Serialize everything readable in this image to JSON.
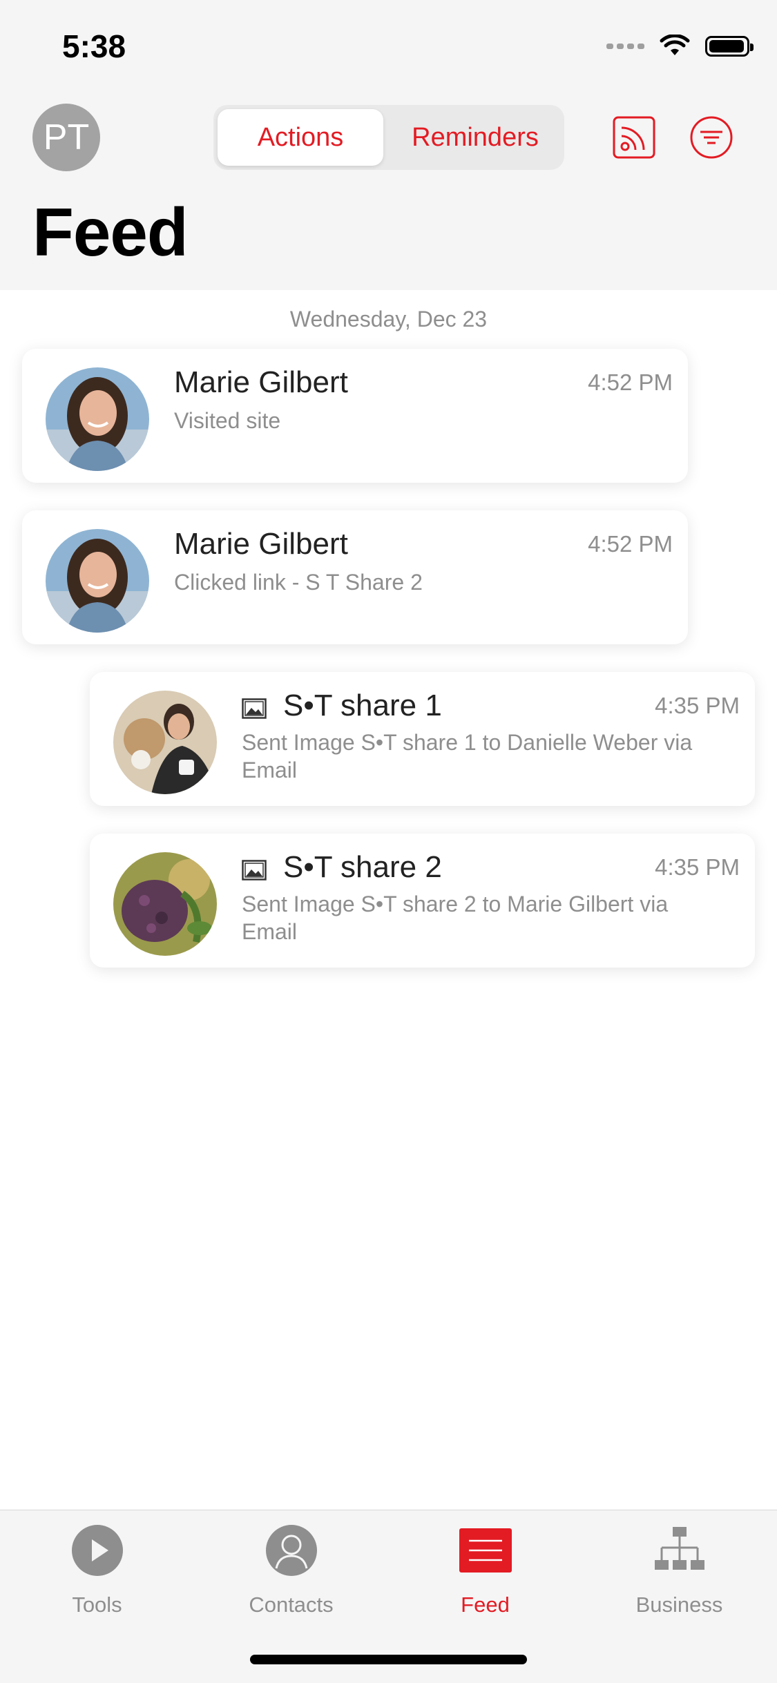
{
  "status_bar": {
    "time": "5:38"
  },
  "header": {
    "avatar_initials": "PT",
    "segments": [
      {
        "label": "Actions",
        "active": true
      },
      {
        "label": "Reminders",
        "active": false
      }
    ],
    "icons": [
      "rss-icon",
      "filter-icon"
    ],
    "title": "Feed"
  },
  "feed": {
    "date_label": "Wednesday, Dec 23",
    "items": [
      {
        "name": "Marie Gilbert",
        "detail": "Visited site",
        "time": "4:52 PM"
      },
      {
        "name": "Marie Gilbert",
        "detail": "Clicked link - S T Share 2",
        "time": "4:52 PM"
      },
      {
        "name": "S•T share 1",
        "detail": "Sent Image S•T share 1 to Danielle Weber via Email",
        "time": "4:35 PM",
        "icon": "image-icon"
      },
      {
        "name": "S•T share 2",
        "detail": "Sent Image S•T share 2 to Marie Gilbert via Email",
        "time": "4:35 PM",
        "icon": "image-icon"
      }
    ]
  },
  "tabbar": {
    "tabs": [
      {
        "label": "Tools",
        "icon": "play-icon",
        "active": false
      },
      {
        "label": "Contacts",
        "icon": "person-icon",
        "active": false
      },
      {
        "label": "Feed",
        "icon": "feed-list-icon",
        "active": true
      },
      {
        "label": "Business",
        "icon": "org-chart-icon",
        "active": false
      }
    ]
  },
  "colors": {
    "accent": "#e31b23",
    "muted": "#8e8e8e",
    "header_bg": "#f5f5f5"
  }
}
